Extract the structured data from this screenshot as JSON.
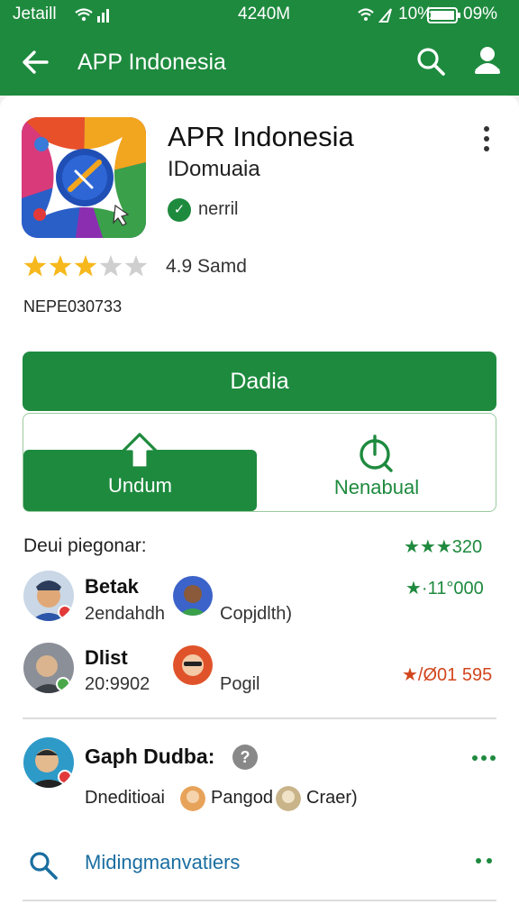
{
  "status_bar": {
    "carrier": "Jetaill",
    "time": "4240M",
    "battery": "10%",
    "battery2": "09%"
  },
  "app_bar": {
    "title": "APP Indonesia"
  },
  "app": {
    "name": "APR Indonesia",
    "subtitle": "IDomuaia",
    "verified_label": "nerril",
    "rating_stars": 3,
    "rating_max": 5,
    "rating_text": "4.9 Samd",
    "code": "NEPE030733"
  },
  "buttons": {
    "primary": "Dadia",
    "segment_a": "Undum",
    "segment_b": "Nenabual"
  },
  "reviews_section": {
    "title": "Deui piegonar:",
    "score": "★★★320",
    "items": [
      {
        "name": "Betak",
        "sub": "2endahdh",
        "tag": "Copjdlth)",
        "score": "★·11°000",
        "score_color": "#1e8a3e"
      },
      {
        "name": "Dlist",
        "sub": "20:9902",
        "tag": "Pogil",
        "score": "★/Ø01 595",
        "score_color": "#d2461e"
      }
    ]
  },
  "group": {
    "title": "Gaph Dudba:",
    "help": "?",
    "items": [
      "Dneditioai",
      "Pangod",
      "Craer)"
    ]
  },
  "link": {
    "label": "Midingmanvatiers"
  },
  "colors": {
    "brand": "#1e8a3e",
    "link": "#1a6ea0",
    "accent_orange": "#d2461e"
  }
}
